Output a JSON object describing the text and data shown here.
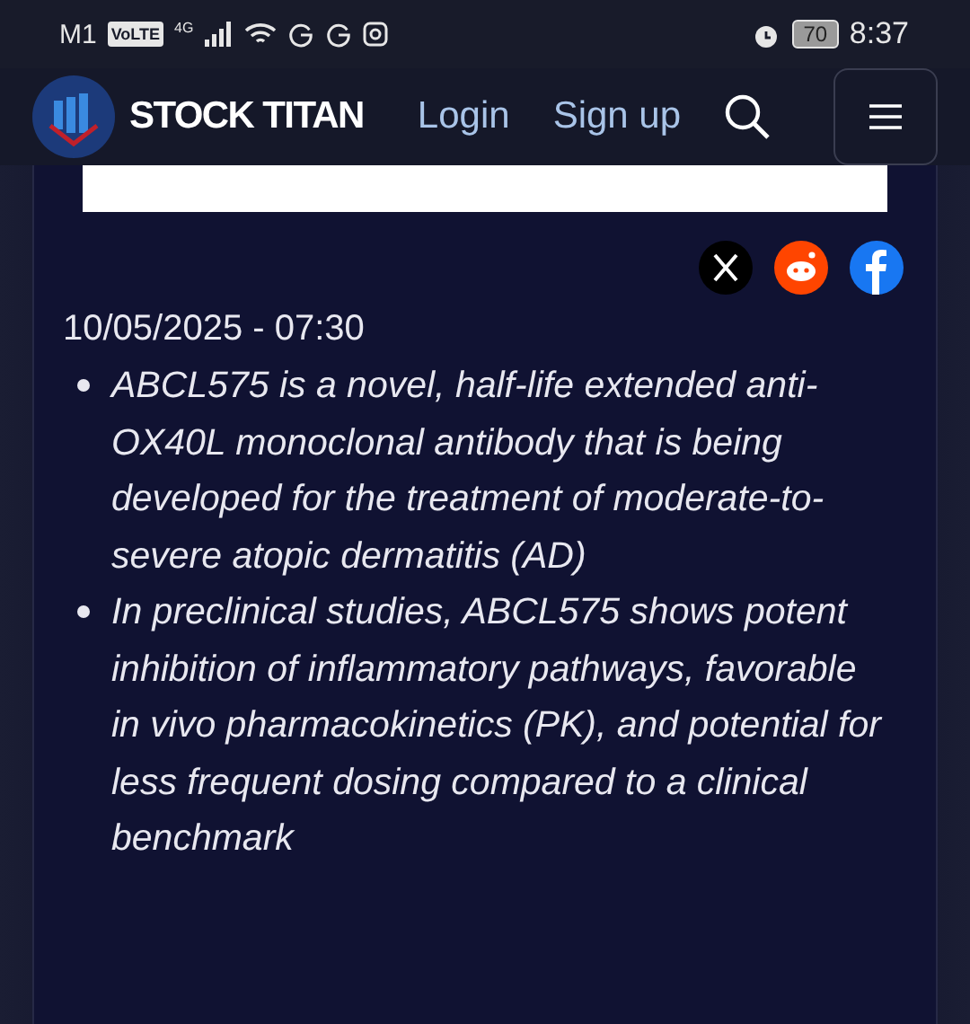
{
  "status_bar": {
    "carrier": "M1",
    "volte": "VoLTE",
    "network": "4G",
    "battery": "70",
    "time": "8:37"
  },
  "nav": {
    "brand": "STOCK TITAN",
    "links": [
      "Login",
      "Sign up"
    ]
  },
  "article": {
    "share": [
      {
        "kind": "x"
      },
      {
        "kind": "reddit"
      },
      {
        "kind": "facebook"
      }
    ],
    "date": "10/05/2025 - 07:30",
    "bullets": [
      "ABCL575 is a novel, half-life extended anti-OX40L monoclonal antibody that is being developed for the treatment of moderate-to-severe atopic dermatitis (AD)",
      "In preclinical studies, ABCL575 shows potent inhibition of inflammatory pathways, favorable in vivo pharmacokinetics (PK), and potential for less frequent dosing compared to a clinical benchmark"
    ]
  }
}
